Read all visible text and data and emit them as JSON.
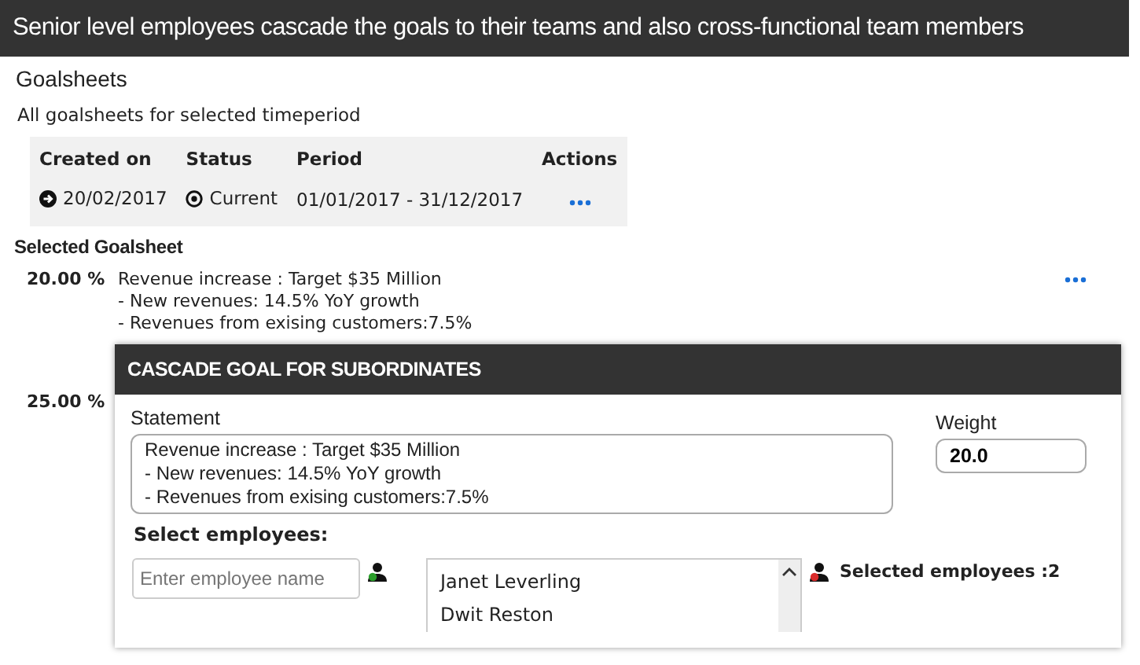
{
  "banner": {
    "title": "Senior level employees cascade the goals to their teams and also cross-functional team members"
  },
  "goalsheets": {
    "heading": "Goalsheets",
    "subtitle": "All goalsheets for selected timeperiod",
    "columns": [
      "Created on",
      "Status",
      "Period",
      "Actions"
    ],
    "rows": [
      {
        "created_on": "20/02/2017",
        "status": "Current",
        "period": "01/01/2017 - 31/12/2017"
      }
    ]
  },
  "selected_goalsheet": {
    "heading": "Selected Goalsheet",
    "goals": [
      {
        "weight": "20.00 %",
        "lines": [
          "Revenue increase : Target $35 Million",
          "- New revenues: 14.5% YoY growth",
          "- Revenues from exising customers:7.5%"
        ]
      },
      {
        "weight": "25.00 %"
      }
    ]
  },
  "dialog": {
    "title": "CASCADE GOAL FOR SUBORDINATES",
    "statement_label": "Statement",
    "statement": "Revenue increase : Target $35 Million\n - New revenues: 14.5% YoY growth\n - Revenues from exising customers:7.5%",
    "weight_label": "Weight",
    "weight": "20.0",
    "select_label": "Select employees:",
    "search_placeholder": "Enter employee name",
    "employees": [
      {
        "name": "Janet Leverling",
        "selected": false
      },
      {
        "name": "Dwit Reston",
        "selected": false
      }
    ],
    "selected_count": "Selected employees :2"
  }
}
